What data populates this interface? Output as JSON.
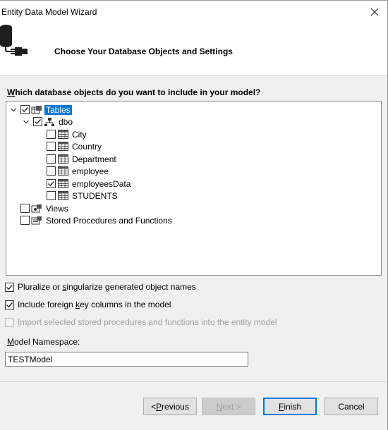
{
  "window": {
    "title": "Entity Data Model Wizard"
  },
  "header": {
    "title": "Choose Your Database Objects and Settings"
  },
  "question": {
    "accel": "W",
    "rest": "hich database objects do you want to include in your model?"
  },
  "tree": {
    "tables": {
      "label": "Tables",
      "checked": true
    },
    "dbo": {
      "label": "dbo",
      "checked": true
    },
    "items": [
      {
        "label": "City",
        "checked": false
      },
      {
        "label": "Country",
        "checked": false
      },
      {
        "label": "Department",
        "checked": false
      },
      {
        "label": "employee",
        "checked": false
      },
      {
        "label": "employeesData",
        "checked": true
      },
      {
        "label": "STUDENTS",
        "checked": false
      }
    ],
    "views": {
      "label": "Views",
      "checked": false
    },
    "procs": {
      "label": "Stored Procedures and Functions",
      "checked": false
    }
  },
  "options": {
    "pluralize": {
      "pre": "Pluralize or ",
      "accel": "s",
      "post": "ingularize generated object names",
      "checked": true
    },
    "foreign_keys": {
      "pre": "Include foreign ",
      "accel": "k",
      "post": "ey columns in the model",
      "checked": true
    },
    "import_procs": {
      "pre": "",
      "accel": "I",
      "post": "mport selected stored procedures and functions into the entity model",
      "checked": false,
      "enabled": false
    }
  },
  "namespace": {
    "accel": "M",
    "rest": "odel Namespace:",
    "value": "TESTModel"
  },
  "buttons": {
    "previous": {
      "pre": "< ",
      "accel": "P",
      "post": "revious"
    },
    "next": {
      "pre": "",
      "accel": "N",
      "post": "ext >"
    },
    "finish": {
      "pre": "",
      "accel": "F",
      "post": "inish"
    },
    "cancel": {
      "label": "Cancel"
    }
  }
}
